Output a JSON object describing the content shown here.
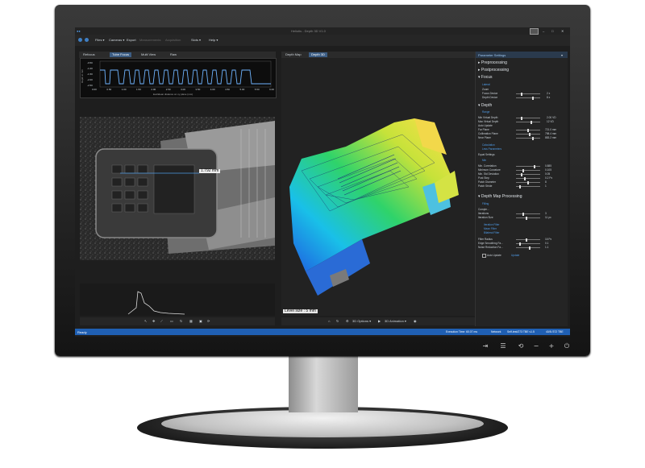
{
  "app": {
    "title": "Heliotis - Depth 3D V1.0",
    "menu": [
      "Files ▾",
      "Cameras ▾",
      "Export",
      "Measurements",
      "Acquisition",
      "Slots ▾",
      "Help ▾"
    ]
  },
  "left_tabs": [
    "Refocus",
    "Tube Focus",
    "Multi View",
    "Raw"
  ],
  "depth_chart": {
    "ylabel": "Depth in mm",
    "xlabel": "Euclidean distance on xy plane (mm)",
    "yticks": [
      "-0.50",
      "-1.00",
      "-1.50",
      "-2.00",
      "-2.50"
    ],
    "xticks": [
      "0.00",
      "0.50",
      "1.00",
      "1.50",
      "2.00",
      "2.50",
      "3.00",
      "3.50",
      "4.00",
      "4.50",
      "5.00",
      "5.50",
      "6.00"
    ]
  },
  "camera": {
    "measurement_label": "1.792 mm"
  },
  "mid_tabs": [
    "Depth Map",
    "Depth 3D"
  ],
  "level_size": "Level size : 5 mm",
  "mid_toolbar": [
    "3D Options ▾",
    "3D Animation ▾"
  ],
  "params": {
    "title": "Parameter Settings",
    "sections": [
      {
        "name": "Preprocessing"
      },
      {
        "name": "Postprocessing"
      },
      {
        "name": "Focus",
        "sub": "Lateral",
        "items": [
          {
            "label": "Zoom",
            "value": ""
          },
          {
            "label": "Focus Device",
            "value": "2 x"
          },
          {
            "label": "Depth Device",
            "value": "8 x"
          }
        ]
      },
      {
        "name": "Depth",
        "sub": "Range",
        "items": [
          {
            "label": "Min Virtual Depth",
            "value": "2.00 VD"
          },
          {
            "label": "Max Virtual Depth",
            "value": "12 VD"
          },
          {
            "label": "Auto Update",
            "value": ""
          },
          {
            "label": "Far Plane",
            "value": "721.0 mm"
          },
          {
            "label": "Collimation Plane",
            "value": "798.4 mm"
          },
          {
            "label": "Near Plane",
            "value": "883.2 mm"
          }
        ],
        "links": [
          "Calculation",
          "Less Parameters",
          "Equal Settings",
          "Min"
        ],
        "items2": [
          {
            "label": "Min. Correlation",
            "value": "0.885"
          },
          {
            "label": "Minimum Curvature",
            "value": "0.105"
          },
          {
            "label": "Min. Std Deviation",
            "value": "0.05"
          },
          {
            "label": "Post Step",
            "value": "0.2 Px"
          },
          {
            "label": "Patch Diameter",
            "value": "8"
          },
          {
            "label": "Patch Stride",
            "value": "1"
          }
        ]
      },
      {
        "name": "Depth Map Processing",
        "sub": "Filling",
        "items": [
          {
            "label": "Comple...",
            "value": ""
          },
          {
            "label": "Iterations",
            "value": "3"
          },
          {
            "label": "Iteration Size",
            "value": "11 px"
          }
        ],
        "links": [
          "Iteration Filter",
          "Mean Filter",
          "Bilateral Filter"
        ],
        "items2": [
          {
            "label": "Filter Radius",
            "value": "16 Px"
          },
          {
            "label": "Edge Smoothing Fa...",
            "value": "0.1"
          },
          {
            "label": "Noise Reduction Fa...",
            "value": "1.1"
          }
        ]
      }
    ],
    "auto_update": "Auto Update",
    "update": "Update"
  },
  "status": {
    "ready": "Ready",
    "time": "Execution Time: 60.07 ms",
    "network": "Network",
    "device": "Self-test/273 TBE v1.5",
    "fps": "40/8 /372 TBE"
  },
  "bezel_buttons": [
    "input-icon",
    "menu-icon",
    "auto-icon",
    "minus-icon",
    "plus-icon",
    "power-icon"
  ]
}
